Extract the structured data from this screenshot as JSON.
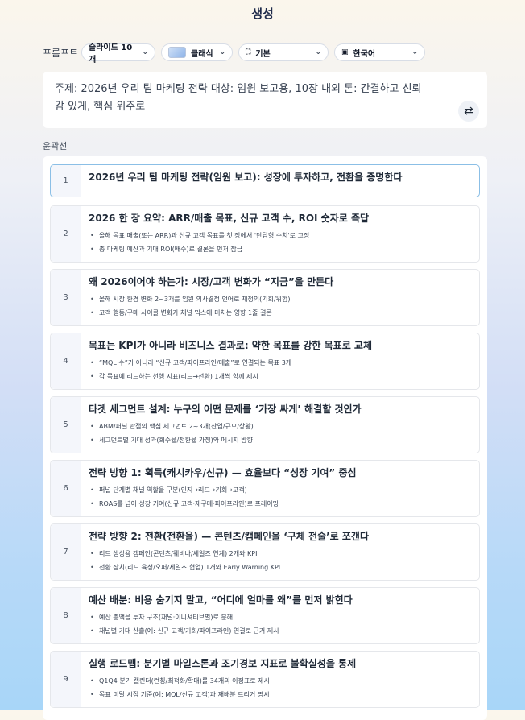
{
  "header": {
    "title": "생성"
  },
  "prompt": {
    "label": "프롬프트",
    "slides": "슬라이드 10개",
    "theme": "클래식",
    "layout": "기본",
    "language": "한국어",
    "text": "주제: 2026년 우리 팀 마케팅 전략 대상: 임원 보고용, 10장 내외 톤: 간결하고 신뢰감 있게, 핵심 위주로"
  },
  "outline": {
    "label": "윤곽선",
    "cards": [
      {
        "num": "1",
        "title": "2026년 우리 팀 마케팅 전략(임원 보고): 성장에 투자하고, 전환을 증명한다",
        "bullets": []
      },
      {
        "num": "2",
        "title": "2026 한 장 요약: ARR/매출 목표, 신규 고객 수, ROI 숫자로 즉답",
        "bullets": [
          "올해 목표 매출(또는 ARR)과 신규 고객 목표를 첫 장에서 '단답형 수치'로 고정",
          "총 마케팅 예산과 기대 ROI(배수)로 결론을 먼저 잠금"
        ]
      },
      {
        "num": "3",
        "title": "왜 2026이어야 하는가: 시장/고객 변화가 “지금”을 만든다",
        "bullets": [
          "올해 시장 환경 변화 2~3개를 임원 의사결정 언어로 재정의(기회/위험)",
          "고객 행동/구매 사이클 변화가 채널 믹스에 미치는 영향 1줄 결론"
        ]
      },
      {
        "num": "4",
        "title": "목표는 KPI가 아니라 비즈니스 결과로: 약한 목표를 강한 목표로 교체",
        "bullets": [
          "“MQL 수”가 아니라 “신규 고객/파이프라인/매출”로 연결되는 목표 3개",
          "각 목표에 리드하는 선행 지표(리드→전환) 1개씩 함께 제시"
        ]
      },
      {
        "num": "5",
        "title": "타겟 세그먼트 설계: 누구의 어떤 문제를 ‘가장 싸게’ 해결할 것인가",
        "bullets": [
          "ABM/퍼널 관점의 핵심 세그먼트 2~3개(산업/규모/상황)",
          "세그먼트별 기대 성과(회수율/전환율 가정)와 메시지 방향"
        ]
      },
      {
        "num": "6",
        "title": "전략 방향 1: 획득(캐시카우/신규) — 효율보다 “성장 기여” 중심",
        "bullets": [
          "퍼널 단계별 채널 역할을 구분(인지→리드→기회→고객)",
          "ROAS를 넘어 성장 기여(신규 고객·재구매·파이프라인)로 프레이밍"
        ]
      },
      {
        "num": "7",
        "title": "전략 방향 2: 전환(전환율) — 콘텐츠/캠페인을 ‘구체 전술’로 쪼갠다",
        "bullets": [
          "리드 생성용 캠페인(콘텐츠/웨비나/세일즈 연계) 2개와 KPI",
          "전환 장치(리드 육성/오퍼/세일즈 협업) 1개와 Early Warning KPI"
        ]
      },
      {
        "num": "8",
        "title": "예산 배분: 비용 숨기지 말고, “어디에 얼마를 왜”를 먼저 밝힌다",
        "bullets": [
          "예산 총액을 투자 구조(채널·이니셔티브별)로 분해",
          "채널별 기대 산출(예: 신규 고객/기회/파이프라인) 연결로 근거 제시"
        ]
      },
      {
        "num": "9",
        "title": "실행 로드맵: 분기별 마일스톤과 조기경보 지표로 불확실성을 통제",
        "bullets": [
          "Q1Q4 분기 캘린더(런칭/최적화/확대)를 34개의 이정표로 제시",
          "목표 미달 시점 기준(예: MQL/신규 고객)과 재배분 트리거 명시"
        ]
      }
    ]
  }
}
